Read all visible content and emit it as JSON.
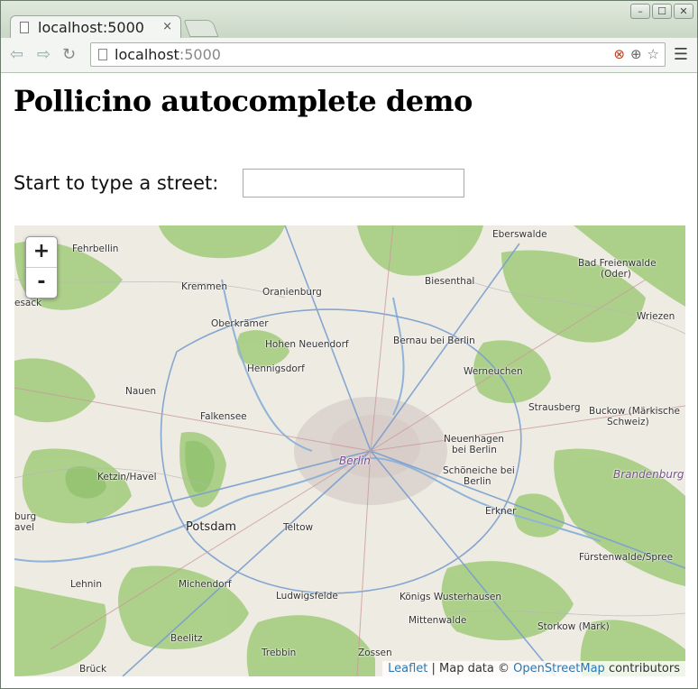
{
  "browser": {
    "tab_title": "localhost:5000",
    "tab_close": "×",
    "url_host": "localhost",
    "url_port": ":5000",
    "window_controls": {
      "minimize": "–",
      "maximize": "☐",
      "close": "✕"
    }
  },
  "page": {
    "heading": "Pollicino autocomplete demo",
    "street_label": "Start to type a street:",
    "street_input_value": "",
    "street_input_placeholder": ""
  },
  "map": {
    "zoom_in": "+",
    "zoom_out": "-",
    "attribution": {
      "leaflet": "Leaflet",
      "separator": " | Map data © ",
      "osm": "OpenStreetMap",
      "suffix": " contributors"
    },
    "places": [
      {
        "name": "Eberswalde"
      },
      {
        "name": "Fehrbellin"
      },
      {
        "name": "esack"
      },
      {
        "name": "Bad Freienwalde"
      },
      {
        "name": "(Oder)"
      },
      {
        "name": "Kremmen"
      },
      {
        "name": "Oranienburg"
      },
      {
        "name": "Biesenthal"
      },
      {
        "name": "Wriezen"
      },
      {
        "name": "Oberkrämer"
      },
      {
        "name": "Hohen Neuendorf"
      },
      {
        "name": "Bernau bei Berlin"
      },
      {
        "name": "Hennigsdorf"
      },
      {
        "name": "Werneuchen"
      },
      {
        "name": "Nauen"
      },
      {
        "name": "Strausberg"
      },
      {
        "name": "Buckow (Märkische"
      },
      {
        "name": "Schweiz)"
      },
      {
        "name": "Falkensee"
      },
      {
        "name": "Neuenhagen"
      },
      {
        "name": "bei Berlin"
      },
      {
        "name": "Berlin"
      },
      {
        "name": "Ketzin/Havel"
      },
      {
        "name": "Schöneiche bei"
      },
      {
        "name": "Berlin"
      },
      {
        "name": "Brandenburg"
      },
      {
        "name": "burg"
      },
      {
        "name": "avel"
      },
      {
        "name": "Potsdam"
      },
      {
        "name": "Teltow"
      },
      {
        "name": "Erkner"
      },
      {
        "name": "Fürstenwalde/Spree"
      },
      {
        "name": "Lehnin"
      },
      {
        "name": "Michendorf"
      },
      {
        "name": "Ludwigsfelde"
      },
      {
        "name": "Königs Wusterhausen"
      },
      {
        "name": "Mittenwalde"
      },
      {
        "name": "Storkow (Mark)"
      },
      {
        "name": "Beelitz"
      },
      {
        "name": "Trebbin"
      },
      {
        "name": "Zossen"
      },
      {
        "name": "Brück"
      }
    ]
  }
}
